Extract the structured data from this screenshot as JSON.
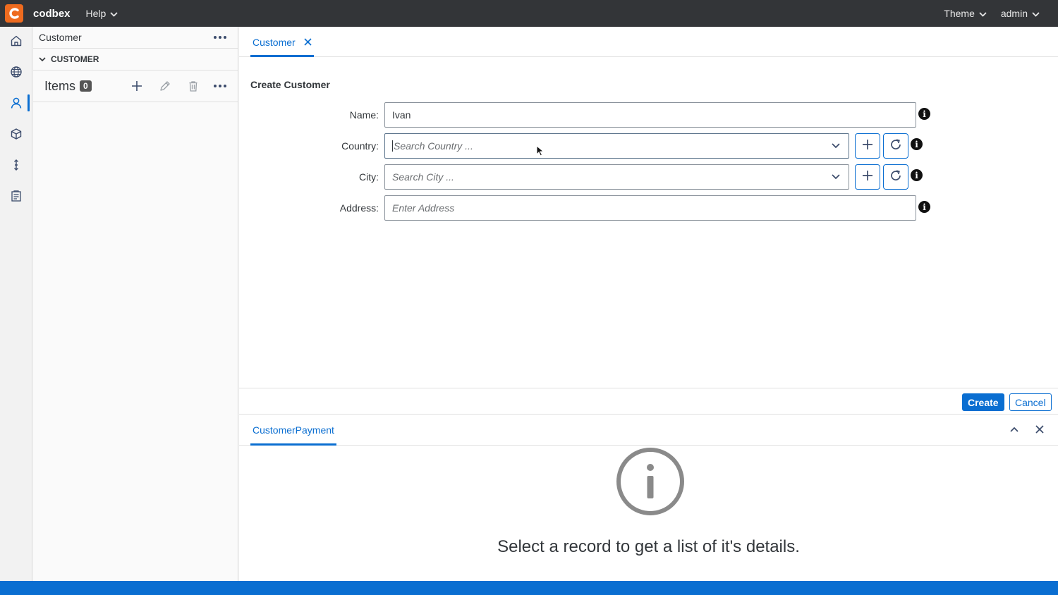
{
  "topbar": {
    "brand": "codbex",
    "help_label": "Help",
    "theme_label": "Theme",
    "user_label": "admin"
  },
  "sidebar": {
    "title": "Customer",
    "group_label": "CUSTOMER",
    "items_label": "Items",
    "items_count": "0"
  },
  "tabs": [
    {
      "label": "Customer"
    }
  ],
  "form": {
    "title": "Create Customer",
    "name_label": "Name:",
    "name_value": "Ivan",
    "country_label": "Country:",
    "country_placeholder": "Search Country ...",
    "city_label": "City:",
    "city_placeholder": "Search City ...",
    "address_label": "Address:",
    "address_placeholder": "Enter Address"
  },
  "actions": {
    "create_label": "Create",
    "cancel_label": "Cancel"
  },
  "details": {
    "tab_label": "CustomerPayment",
    "empty_message": "Select a record to get a list of it's details."
  },
  "colors": {
    "accent": "#0a6ed1",
    "topbar": "#333538",
    "logo": "#ee6b1f"
  }
}
